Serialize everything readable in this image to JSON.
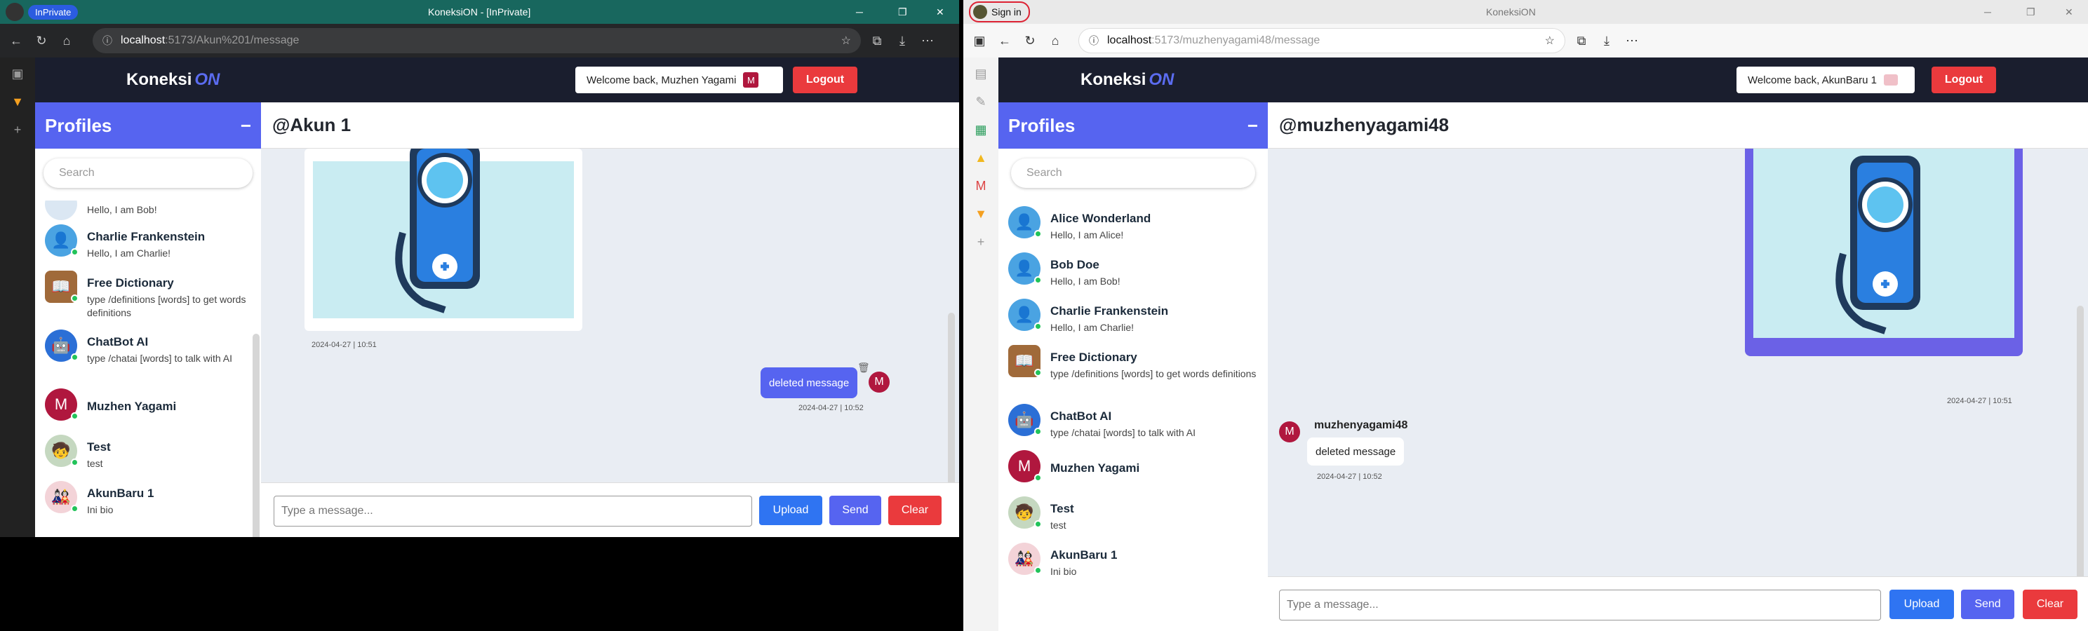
{
  "left": {
    "tab": {
      "inprivate": "InPrivate",
      "title": "KoneksiON - [InPrivate]"
    },
    "url": {
      "host": "localhost",
      "path": ":5173/Akun%201/message"
    },
    "nav": {
      "brand": "Koneksi",
      "brand_on": "ON",
      "welcome": "Welcome back, Muzhen Yagami",
      "badge": "M",
      "logout": "Logout"
    },
    "sidebar": {
      "title": "Profiles",
      "collapse": "−",
      "search_placeholder": "Search",
      "partial_bio": "Hello, I am Bob!",
      "items": [
        {
          "name": "Charlie Frankenstein",
          "bio": "Hello, I am Charlie!"
        },
        {
          "name": "Free Dictionary",
          "bio": "type /definitions [words] to get words definitions"
        },
        {
          "name": "ChatBot AI",
          "bio": "type /chatai [words] to talk with AI"
        },
        {
          "name": "Muzhen Yagami",
          "bio": ""
        },
        {
          "name": "Test",
          "bio": "test"
        },
        {
          "name": "AkunBaru 1",
          "bio": "Ini bio"
        }
      ]
    },
    "chat": {
      "title": "@Akun 1",
      "image_ts": "2024-04-27 | 10:51",
      "msg": "deleted message",
      "msg_ts": "2024-04-27 | 10:52",
      "avatar": "M",
      "input_placeholder": "Type a message...",
      "upload": "Upload",
      "send": "Send",
      "clear": "Clear"
    }
  },
  "right": {
    "tab": {
      "signin": "Sign in",
      "title": "KoneksiON"
    },
    "url": {
      "host": "localhost",
      "path": ":5173/muzhenyagami48/message"
    },
    "nav": {
      "brand": "Koneksi",
      "brand_on": "ON",
      "welcome": "Welcome back, AkunBaru 1",
      "logout": "Logout"
    },
    "sidebar": {
      "title": "Profiles",
      "collapse": "−",
      "search_placeholder": "Search",
      "items": [
        {
          "name": "Alice Wonderland",
          "bio": "Hello, I am Alice!"
        },
        {
          "name": "Bob Doe",
          "bio": "Hello, I am Bob!"
        },
        {
          "name": "Charlie Frankenstein",
          "bio": "Hello, I am Charlie!"
        },
        {
          "name": "Free Dictionary",
          "bio": "type /definitions [words] to get words definitions"
        },
        {
          "name": "ChatBot AI",
          "bio": "type /chatai [words] to talk with AI"
        },
        {
          "name": "Muzhen Yagami",
          "bio": ""
        },
        {
          "name": "Test",
          "bio": "test"
        },
        {
          "name": "AkunBaru 1",
          "bio": "Ini bio"
        }
      ]
    },
    "chat": {
      "title": "@muzhenyagami48",
      "image_ts": "2024-04-27 | 10:51",
      "sender": "muzhenyagami48",
      "msg": "deleted message",
      "msg_ts": "2024-04-27 | 10:52",
      "avatar": "M",
      "input_placeholder": "Type a message...",
      "upload": "Upload",
      "send": "Send",
      "clear": "Clear"
    }
  },
  "colors": {
    "nav": "#1a1e2e",
    "accent": "#5664f0",
    "danger": "#ea3a3d",
    "online": "#22c35a",
    "upload": "#2f74f2"
  }
}
